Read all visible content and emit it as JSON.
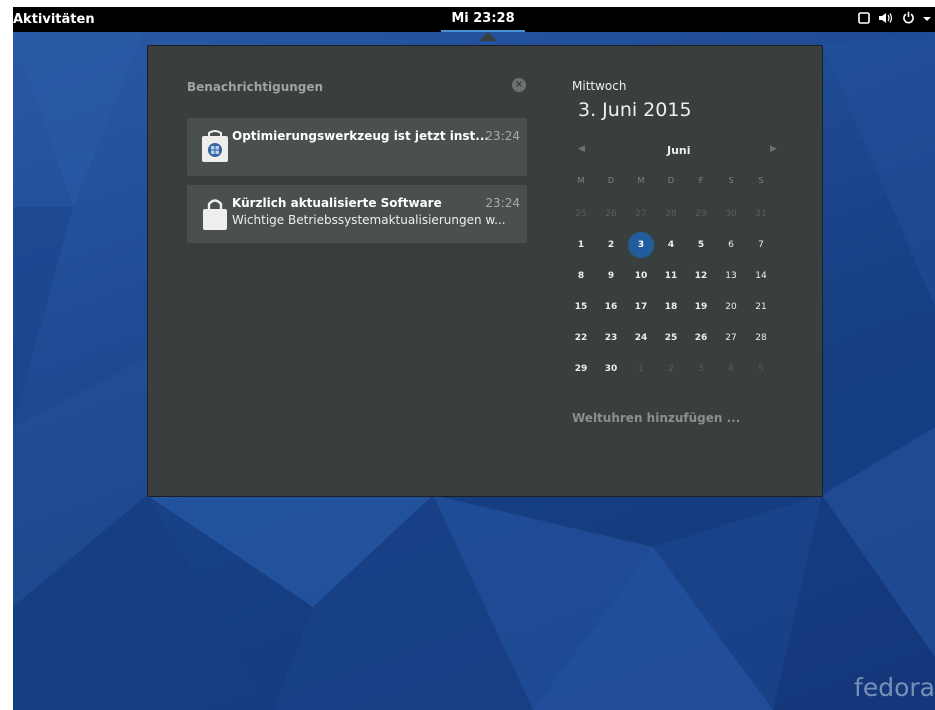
{
  "topbar": {
    "activities_label": "Aktivitäten",
    "clock_label": "Mi 23:28",
    "system_icons": [
      "screen-icon",
      "volume-icon",
      "power-icon",
      "chevron-down-icon"
    ]
  },
  "notifications": {
    "header": "Benachrichtigungen",
    "items": [
      {
        "icon": "software-center-icon",
        "title": "Optimierungswerkzeug ist jetzt inst...",
        "time": "23:24",
        "body": ""
      },
      {
        "icon": "shopping-bag-icon",
        "title": "Kürzlich aktualisierte Software",
        "time": "23:24",
        "body": "Wichtige Betriebssystemaktualisierungen w..."
      }
    ]
  },
  "calendar": {
    "weekday": "Mittwoch",
    "date": "3. Juni 2015",
    "month": "Juni",
    "prev_label": "◀",
    "next_label": "▶",
    "day_headers": [
      "M",
      "D",
      "M",
      "D",
      "F",
      "S",
      "S"
    ],
    "weeks": [
      [
        "25",
        "26",
        "27",
        "28",
        "29",
        "30",
        "31"
      ],
      [
        "1",
        "2",
        "3",
        "4",
        "5",
        "6",
        "7"
      ],
      [
        "8",
        "9",
        "10",
        "11",
        "12",
        "13",
        "14"
      ],
      [
        "15",
        "16",
        "17",
        "18",
        "19",
        "20",
        "21"
      ],
      [
        "22",
        "23",
        "24",
        "25",
        "26",
        "27",
        "28"
      ],
      [
        "29",
        "30",
        "1",
        "2",
        "3",
        "4",
        "5"
      ]
    ],
    "today": "3",
    "world_clocks_label": "Weltuhren hinzufügen ..."
  },
  "wallpaper": {
    "logo_text": "fedora"
  },
  "colors": {
    "accent": "#215d9c",
    "panel": "#393f3f",
    "topbar": "#000000"
  }
}
